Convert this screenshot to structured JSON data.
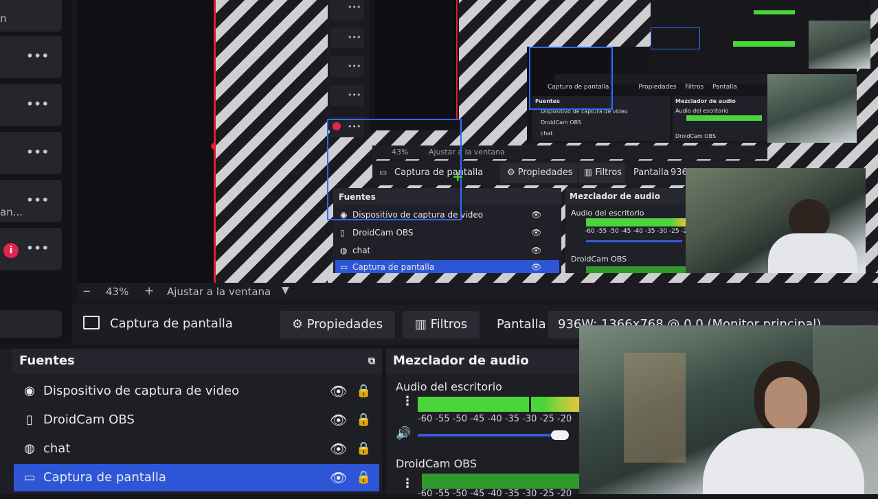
{
  "left_scenes": {
    "rows": [
      {
        "label": "n"
      },
      {
        "label": ""
      },
      {
        "label": ""
      },
      {
        "label": ""
      },
      {
        "label": "an..."
      },
      {
        "label": ""
      }
    ],
    "more_glyph": "•••",
    "record_glyph": "i"
  },
  "preview": {
    "mini": {
      "zoom": "43%",
      "fit": "Ajustar a la ventana",
      "source_name": "Captura de pantalla",
      "props": "Propiedades",
      "filters": "Filtros",
      "screen": "Pantalla",
      "screen_val": "936",
      "sources_title": "Fuentes",
      "sources": [
        "Dispositivo de captura de video",
        "DroidCam OBS",
        "chat",
        "Captura de pantalla"
      ],
      "mixer_title": "Mezclador de audio",
      "mixer_ch1": "Audio del escritorio",
      "mixer_ch2": "DroidCam OBS",
      "ticks": "-60 -55 -50 -45 -40 -35 -30 -25 -20"
    },
    "mini2": {
      "source_name": "Captura de pantalla",
      "props": "Propiedades",
      "filters": "Filtros",
      "screen": "Pantalla",
      "sources_title": "Fuentes",
      "sources": [
        "Dispositivo de captura de video",
        "DroidCam OBS",
        "chat"
      ],
      "mixer_title": "Mezclador de audio",
      "mixer_ch1": "Audio del escritorio",
      "mixer_ch2": "DroidCam OBS"
    }
  },
  "zoom_bar": {
    "minus": "−",
    "zoom": "43%",
    "plus": "+",
    "fit": "Ajustar a la ventana"
  },
  "controls": {
    "source_name": "Captura de pantalla",
    "properties": "Propiedades",
    "filters": "Filtros",
    "screen_label": "Pantalla",
    "screen_value": "936W: 1366x768 @ 0,0 (Monitor principal)"
  },
  "sources_panel": {
    "title": "Fuentes",
    "items": [
      {
        "label": "Dispositivo de captura de video",
        "icon": "camera-icon"
      },
      {
        "label": "DroidCam OBS",
        "icon": "file-icon"
      },
      {
        "label": "chat",
        "icon": "globe-icon"
      },
      {
        "label": "Captura de pantalla",
        "icon": "monitor-icon",
        "selected": true
      }
    ]
  },
  "mixer": {
    "title": "Mezclador de audio",
    "channels": [
      {
        "name": "Audio del escritorio",
        "ticks": "-60 -55 -50 -45 -40 -35 -30 -25 -20"
      },
      {
        "name": "DroidCam OBS",
        "ticks": "-60 -55 -50 -45 -40 -35 -30 -25 -20"
      }
    ]
  },
  "colors": {
    "accent": "#2c56d6",
    "record": "#e3244c",
    "meter": "#4bd43b",
    "selection": "#2f6bff"
  }
}
